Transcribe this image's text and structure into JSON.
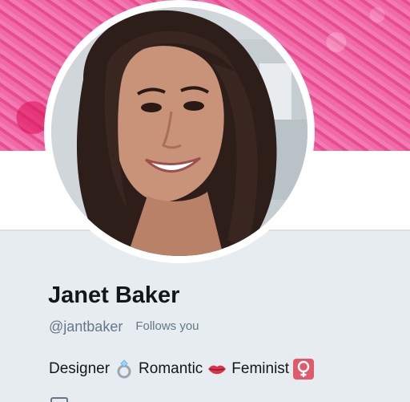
{
  "profile": {
    "name": "Janet Baker",
    "handle": "@jantbaker",
    "follows_you": "Follows you",
    "bio": {
      "word1": "Designer",
      "word2": "Romantic",
      "word3": "Feminist",
      "emoji1": "ring-icon",
      "emoji2": "lips-icon",
      "emoji3": "female-sign-icon"
    }
  },
  "colors": {
    "banner": "#e64c8e",
    "background": "#e6ecf0",
    "text_primary": "#14171a",
    "text_secondary": "#657786"
  }
}
